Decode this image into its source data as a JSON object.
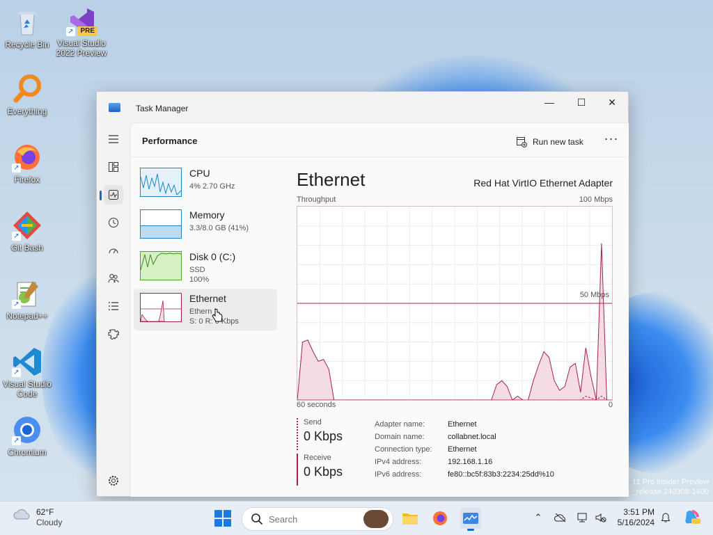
{
  "desktop": {
    "icons": [
      {
        "label": "Recycle Bin",
        "icon": "recycle-bin-icon"
      },
      {
        "label": "Visual Studio 2022 Preview",
        "icon": "visual-studio-icon",
        "badge": "PRE"
      },
      {
        "label": "Everything",
        "icon": "everything-search-icon"
      },
      {
        "label": "Firefox",
        "icon": "firefox-icon"
      },
      {
        "label": "Git Bash",
        "icon": "git-bash-icon"
      },
      {
        "label": "Notepad++",
        "icon": "notepad-plus-plus-icon"
      },
      {
        "label": "Visual Studio Code",
        "icon": "vscode-icon"
      },
      {
        "label": "Chromium",
        "icon": "chromium-icon"
      }
    ],
    "watermark": [
      "11 Pro Insider Preview",
      "_release.240308-1400"
    ]
  },
  "window": {
    "title": "Task Manager",
    "controls": {
      "minimize": "—",
      "maximize": "☐",
      "close": "✕"
    }
  },
  "nav": {
    "items": [
      {
        "name": "hamburger-menu",
        "icon": "menu-icon"
      },
      {
        "name": "processes",
        "icon": "processes-icon"
      },
      {
        "name": "performance",
        "icon": "performance-icon",
        "active": true
      },
      {
        "name": "app-history",
        "icon": "app-history-icon"
      },
      {
        "name": "startup-apps",
        "icon": "startup-apps-icon"
      },
      {
        "name": "users",
        "icon": "users-icon"
      },
      {
        "name": "details",
        "icon": "details-icon"
      },
      {
        "name": "services",
        "icon": "services-icon"
      }
    ],
    "settings_icon": "settings-icon"
  },
  "header": {
    "page_title": "Performance",
    "run_new_task": "Run new task",
    "more": "···"
  },
  "resources": [
    {
      "name": "CPU",
      "sub1": "4% 2.70 GHz",
      "sub2": "",
      "color": "#1a86c9",
      "fill": "#e4f1f9"
    },
    {
      "name": "Memory",
      "sub1": "3.3/8.0 GB (41%)",
      "sub2": "",
      "color": "#1a86c9",
      "fill": "#e4f1f9"
    },
    {
      "name": "Disk 0 (C:)",
      "sub1": "SSD",
      "sub2": "100%",
      "color": "#4aa428",
      "fill": "#d6efc3"
    },
    {
      "name": "Ethernet",
      "sub1": "Ethern",
      "sub2": "S: 0 R: 0 Kbps",
      "color": "#a4204d",
      "fill": "#f5dbe4",
      "selected": true
    }
  ],
  "detail": {
    "title": "Ethernet",
    "adapter": "Red Hat VirtIO Ethernet Adapter",
    "throughput_label": "Throughput",
    "max_label": "100 Mbps",
    "mid_label": "50 Mbps",
    "x_left": "60 seconds",
    "x_right": "0",
    "send_label": "Send",
    "send_value": "0 Kbps",
    "receive_label": "Receive",
    "receive_value": "0 Kbps",
    "properties": [
      {
        "k": "Adapter name:",
        "v": "Ethernet"
      },
      {
        "k": "Domain name:",
        "v": "collabnet.local"
      },
      {
        "k": "Connection type:",
        "v": "Ethernet"
      },
      {
        "k": "IPv4 address:",
        "v": "192.168.1.16"
      },
      {
        "k": "IPv6 address:",
        "v": "fe80::bc5f:83b3:2234:25dd%10"
      }
    ]
  },
  "throughput_chart": {
    "x_unit": "seconds ago",
    "y_unit": "Mbps",
    "ylim": [
      0,
      100
    ],
    "scale_line": 50,
    "receive": [
      0,
      30,
      31,
      25,
      20,
      21,
      16,
      0,
      0,
      0,
      0,
      0,
      0,
      0,
      0,
      0,
      0,
      0,
      0,
      0,
      0,
      0,
      0,
      0,
      0,
      0,
      0,
      0,
      0,
      0,
      0,
      0,
      0,
      0,
      0,
      0,
      0,
      0,
      8,
      10,
      7,
      0,
      2,
      0,
      0,
      10,
      18,
      25,
      22,
      10,
      5,
      7,
      17,
      19,
      4,
      27,
      12,
      0,
      81,
      0,
      0
    ],
    "send": [
      0,
      0,
      0,
      0,
      0,
      0,
      0,
      0,
      0,
      0,
      0,
      0,
      0,
      0,
      0,
      0,
      0,
      0,
      0,
      0,
      0,
      0,
      0,
      0,
      0,
      0,
      0,
      0,
      0,
      0,
      0,
      0,
      0,
      0,
      0,
      0,
      0,
      0,
      0,
      0,
      0,
      0,
      0,
      0,
      0,
      0,
      0,
      0,
      0,
      0,
      0,
      0,
      0,
      0,
      0,
      2,
      1,
      0,
      2,
      0,
      0
    ]
  },
  "taskbar": {
    "weather_temp": "62°F",
    "weather_desc": "Cloudy",
    "search_placeholder": "Search",
    "apps": [
      "file-explorer-icon",
      "firefox-icon",
      "task-manager-icon"
    ],
    "clock_time": "3:51 PM",
    "clock_date": "5/16/2024"
  },
  "colors": {
    "accent": "#1a67c8",
    "ethernet": "#a4204d",
    "ethernet_fill": "#f5dbe4"
  }
}
